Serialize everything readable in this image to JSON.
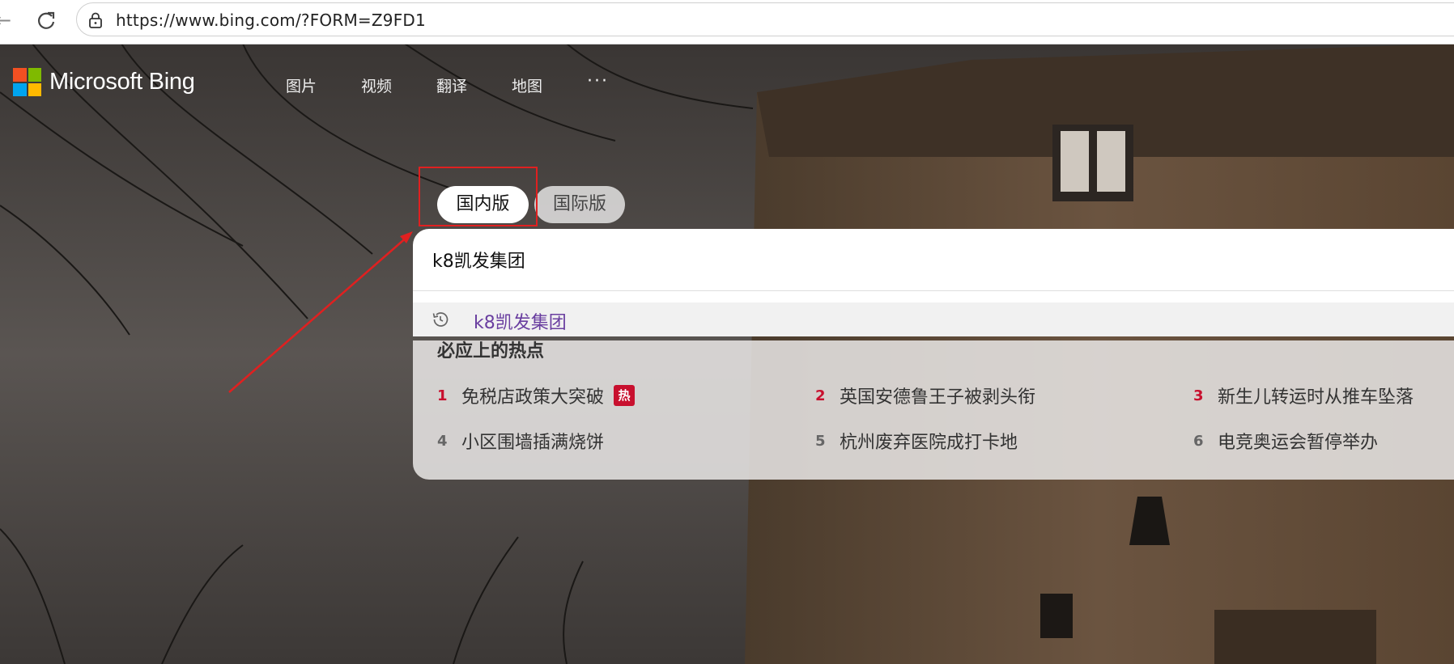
{
  "browser": {
    "url": "https://www.bing.com/?FORM=Z9FD1",
    "back_glyph": "←"
  },
  "header": {
    "logo_text": "Microsoft Bing",
    "logo_colors": [
      "#f25022",
      "#7fba00",
      "#00a4ef",
      "#ffb900"
    ],
    "nav_items": [
      "图片",
      "视频",
      "翻译",
      "地图"
    ],
    "more_label": "···"
  },
  "region": {
    "active": "国内版",
    "inactive": "国际版"
  },
  "search": {
    "value": "k8凯发集团",
    "suggestion": "k8凯发集团"
  },
  "hot": {
    "title": "必应上的热点",
    "badge": "热",
    "items": [
      {
        "rank": "1",
        "text": "免税店政策大突破"
      },
      {
        "rank": "2",
        "text": "英国安德鲁王子被剥头衔"
      },
      {
        "rank": "3",
        "text": "新生儿转运时从推车坠落"
      },
      {
        "rank": "4",
        "text": "小区围墙插满烧饼"
      },
      {
        "rank": "5",
        "text": "杭州废弃医院成打卡地"
      },
      {
        "rank": "6",
        "text": "电竞奥运会暂停举办"
      }
    ]
  },
  "annotation_color": "#e02020"
}
